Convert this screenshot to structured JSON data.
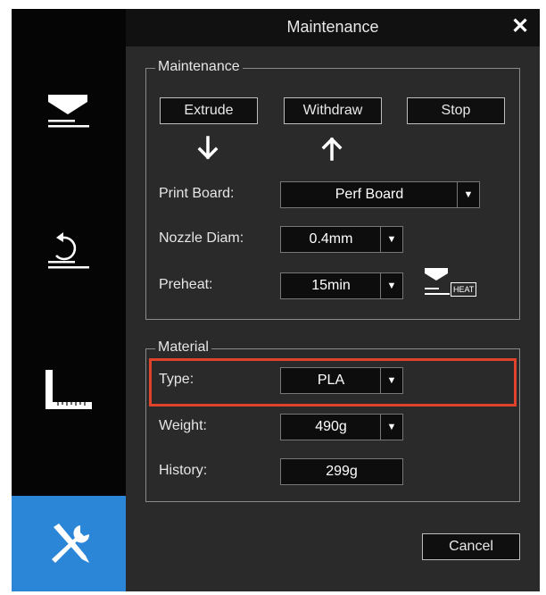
{
  "window": {
    "title": "Maintenance",
    "close_symbol": "✕"
  },
  "sidebar": {
    "items": [
      {
        "name": "extruder",
        "icon": "extruder-icon",
        "active": false
      },
      {
        "name": "rotate",
        "icon": "rotate-icon",
        "active": false
      },
      {
        "name": "ruler",
        "icon": "ruler-icon",
        "active": false
      },
      {
        "name": "tools",
        "icon": "tools-icon",
        "active": true
      }
    ],
    "active_color": "#2c86d8"
  },
  "maintenance": {
    "group_label": "Maintenance",
    "extrude_label": "Extrude",
    "withdraw_label": "Withdraw",
    "stop_label": "Stop",
    "print_board": {
      "label": "Print Board:",
      "value": "Perf Board"
    },
    "nozzle_diam": {
      "label": "Nozzle Diam:",
      "value": "0.4mm"
    },
    "preheat": {
      "label": "Preheat:",
      "value": "15min",
      "heat_label": "HEAT"
    }
  },
  "material": {
    "group_label": "Material",
    "type": {
      "label": "Type:",
      "value": "PLA"
    },
    "weight": {
      "label": "Weight:",
      "value": "490g"
    },
    "history": {
      "label": "History:",
      "value": "299g"
    },
    "highlight_color": "#e0432c"
  },
  "footer": {
    "cancel_label": "Cancel"
  }
}
